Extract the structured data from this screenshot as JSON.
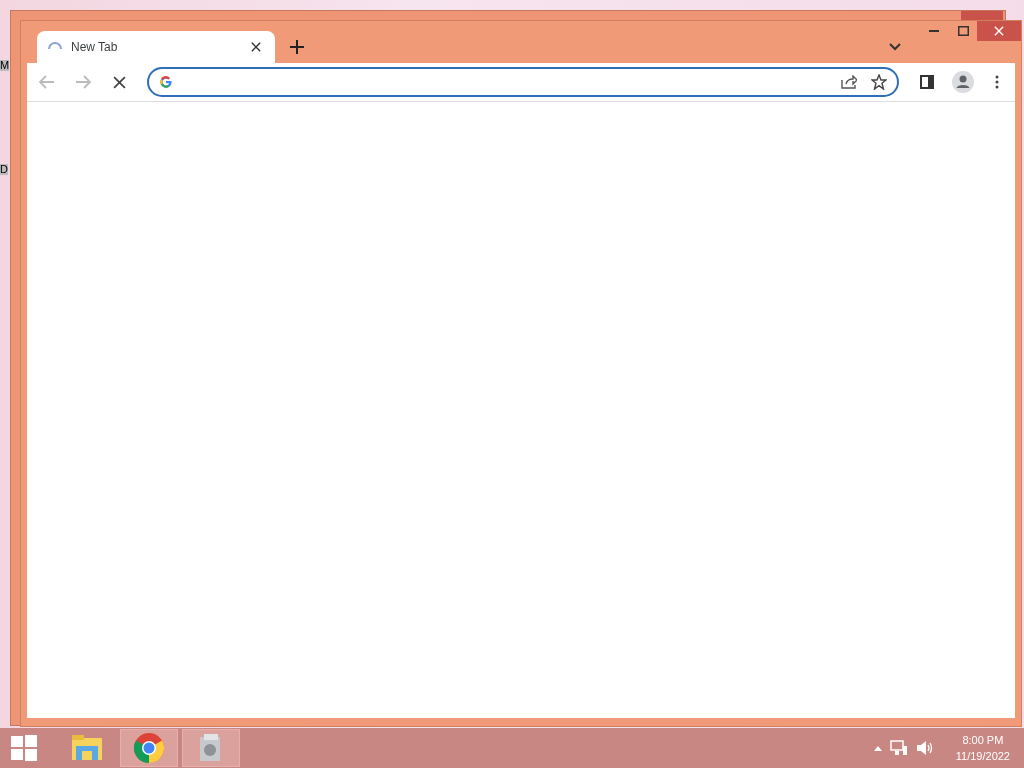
{
  "desktop_labels": [
    "M",
    "D"
  ],
  "browser": {
    "tabs": [
      {
        "title": "New Tab",
        "loading": true,
        "selected": true
      }
    ],
    "back_disabled": true,
    "forward_disabled": true
  },
  "taskbar": {
    "apps": [
      {
        "kind": "folder",
        "selected": false
      },
      {
        "kind": "chrome",
        "selected": true
      },
      {
        "kind": "app",
        "selected": true
      }
    ],
    "time": "8:00 PM",
    "date": "11/19/2022"
  }
}
